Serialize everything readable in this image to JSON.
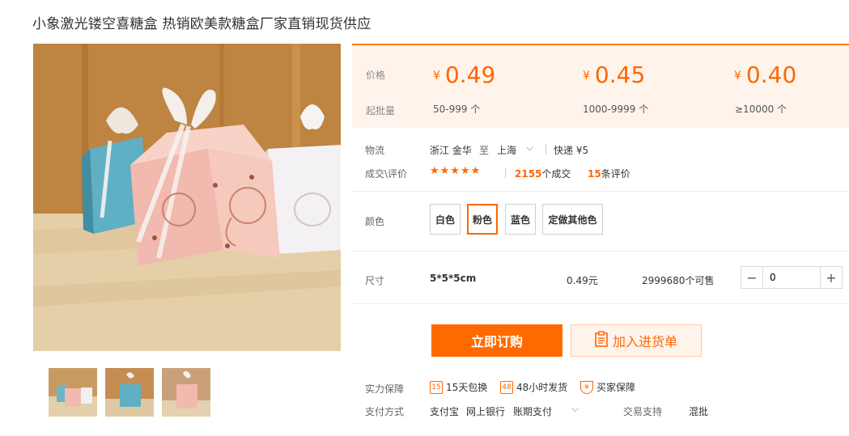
{
  "title": "小象激光镂空喜糖盒 热销欧美款糖盒厂家直销现货供应",
  "price_panel": {
    "price_label": "价格",
    "moq_label": "起批量",
    "currency": "¥",
    "tiers": [
      {
        "price": "0.49",
        "qty": "50-999 个"
      },
      {
        "price": "0.45",
        "qty": "1000-9999 个"
      },
      {
        "price": "0.40",
        "qty": "≥10000 个"
      }
    ]
  },
  "logistics": {
    "label": "物流",
    "from": "浙江 金华",
    "to_word": "至",
    "to": "上海",
    "shipping": "快递 ¥5"
  },
  "deals": {
    "label": "成交\\评价",
    "rating": 5,
    "deal_count": "2155",
    "deal_suffix": "个成交",
    "review_count": "15",
    "review_suffix": "条评价"
  },
  "colors": {
    "label": "颜色",
    "options": [
      "白色",
      "粉色",
      "蓝色",
      "定做其他色"
    ],
    "selected": "粉色"
  },
  "size": {
    "label": "尺寸",
    "value": "5*5*5cm",
    "price": "0.49元",
    "stock": "2999680个可售",
    "quantity": "0"
  },
  "actions": {
    "buy": "立即订购",
    "cart": "加入进货单"
  },
  "guarantee": {
    "label": "实力保障",
    "items": [
      "15天包换",
      "48小时发货",
      "买家保障"
    ]
  },
  "payment": {
    "label": "支付方式",
    "methods": [
      "支付宝",
      "网上银行",
      "账期支付"
    ],
    "trade_label": "交易支持",
    "trade_value": "混批"
  },
  "thumbnails": [
    "pink-elephant-box-group",
    "blue-elephant-box",
    "pink-elephant-box"
  ],
  "accent_color": "#ff6600"
}
